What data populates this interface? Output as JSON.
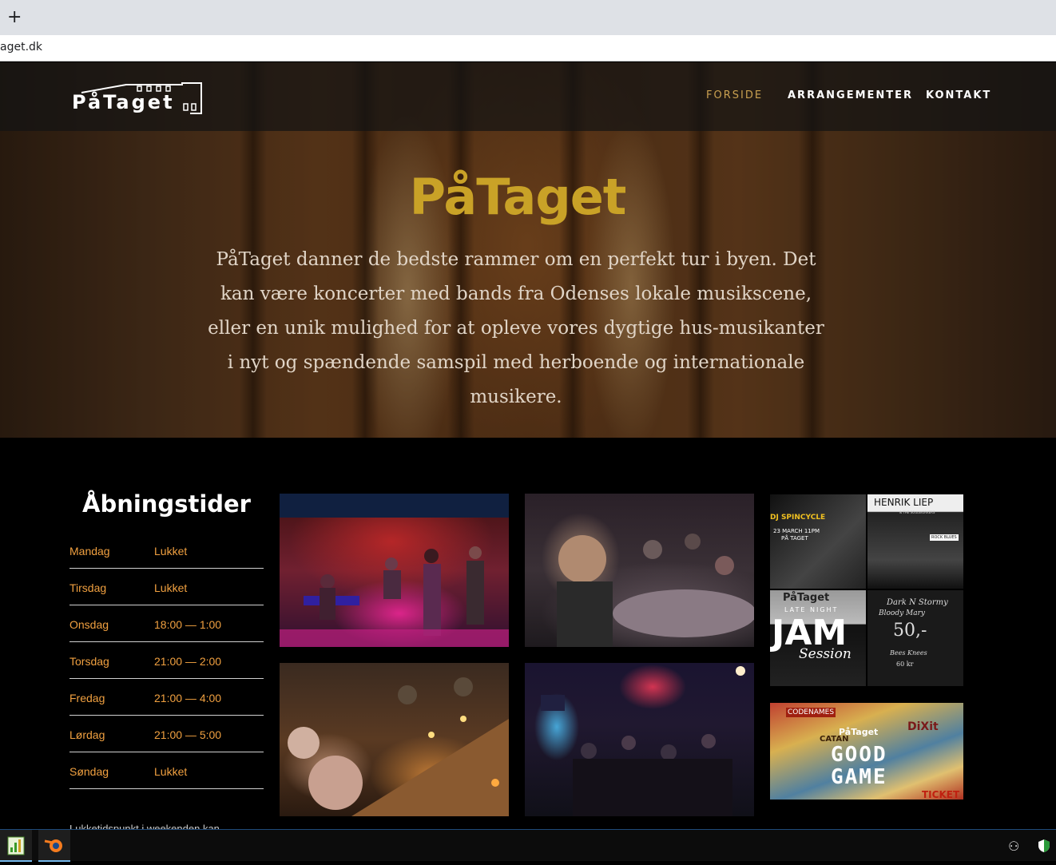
{
  "browser": {
    "new_tab_glyph": "+",
    "url": "aget.dk"
  },
  "header": {
    "logo_text": "PåTaget",
    "nav": [
      {
        "label": "FORSIDE",
        "active": true
      },
      {
        "label": "ARRANGEMENTER",
        "active": false
      },
      {
        "label": "KONTAKT",
        "active": false
      }
    ]
  },
  "hero": {
    "title": "PåTaget",
    "text": "PåTaget danner de bedste rammer om en perfekt tur i byen. Det kan være koncerter med  bands fra Odenses lokale musikscene, eller en unik mulighed for at opleve vores dygtige hus-musikanter i nyt og spændende samspil med herboende og internationale musikere."
  },
  "hours": {
    "title": "Åbningstider",
    "rows": [
      {
        "day": "Mandag",
        "time": "Lukket"
      },
      {
        "day": "Tirsdag",
        "time": "Lukket"
      },
      {
        "day": "Onsdag",
        "time": "18:00 — 1:00"
      },
      {
        "day": "Torsdag",
        "time": "21:00 — 2:00"
      },
      {
        "day": "Fredag",
        "time": "21:00 — 4:00"
      },
      {
        "day": "Lørdag",
        "time": "21:00 — 5:00"
      },
      {
        "day": "Søndag",
        "time": "Lukket"
      }
    ],
    "note": "Lukketidspunkt i weekenden kan"
  },
  "posters": {
    "dj_spincycle": "DJ SPINCYCLE",
    "dj_date": "23 MARCH 11PM",
    "dj_place": "PÅ TAGET",
    "henrik_liep": "HENRIK LIEP",
    "henrik_sub": "& THE SOULWORKERS",
    "henrik_tag": "ROCK BLUES",
    "jam_top": "PåTaget",
    "jam_sub": "LATE NIGHT",
    "jam_big": "JAM",
    "jam_script": "Session",
    "board_title": "Dark N Stormy",
    "board_line2": "Bloody Mary",
    "board_price": "50,-",
    "board_line4": "Bees Knees",
    "board_line5": "60 kr",
    "game_brand1": "CODENAMES",
    "game_brand2": "CATAN",
    "game_brand3": "DiXit",
    "game_logo": "PåTaget",
    "game_title1": "GOOD",
    "game_title2": "GAME",
    "game_bottom": "TICKET"
  },
  "colors": {
    "accent_gold": "#c9a227",
    "nav_active": "#c9a050",
    "hours_text": "#f0a040"
  },
  "taskbar": {
    "apps": [
      "chart-app-icon",
      "blender-icon"
    ],
    "tray": [
      "people-icon",
      "shield-icon"
    ]
  }
}
